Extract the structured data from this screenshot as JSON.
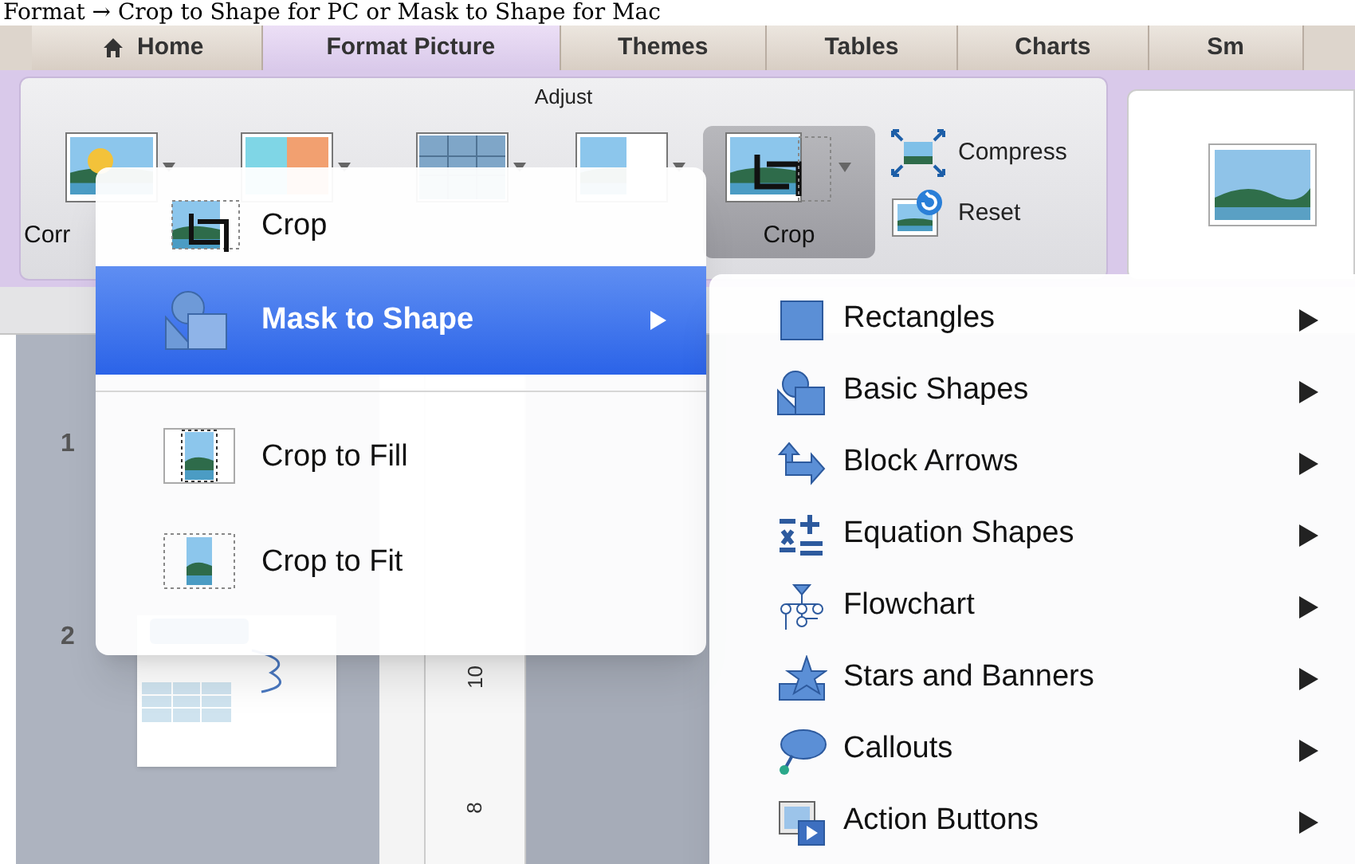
{
  "caption": "Format → Crop to Shape for PC or Mask to Shape for Mac",
  "tabs": [
    {
      "label": "Home",
      "kind": "home",
      "selected": false
    },
    {
      "label": "Format Picture",
      "kind": "plain",
      "selected": true
    },
    {
      "label": "Themes",
      "kind": "plain",
      "selected": false
    },
    {
      "label": "Tables",
      "kind": "plain",
      "selected": false
    },
    {
      "label": "Charts",
      "kind": "plain",
      "selected": false
    },
    {
      "label": "Sm",
      "kind": "plain",
      "selected": false
    }
  ],
  "ribbon": {
    "group": "Adjust",
    "buttons": [
      {
        "kind": "corrections",
        "label": "Corr",
        "pressed": false
      },
      {
        "kind": "color",
        "pressed": false
      },
      {
        "kind": "artistic",
        "pressed": false
      },
      {
        "kind": "background",
        "pressed": false
      },
      {
        "kind": "crop",
        "label": "Crop",
        "pressed": true
      }
    ],
    "small_buttons": [
      {
        "kind": "compress",
        "label": "Compress"
      },
      {
        "kind": "reset",
        "label": "Reset"
      }
    ]
  },
  "slides": [
    {
      "number": "1"
    },
    {
      "number": "2"
    }
  ],
  "ruler_labels": [
    "10",
    "8"
  ],
  "menu": {
    "items": [
      {
        "kind": "item",
        "label": "Crop",
        "selected": false,
        "has_submenu": false
      },
      {
        "kind": "item",
        "label": "Mask to Shape",
        "selected": true,
        "has_submenu": true
      },
      {
        "kind": "separator"
      },
      {
        "kind": "item",
        "label": "Crop to Fill",
        "selected": false,
        "has_submenu": false
      },
      {
        "kind": "item",
        "label": "Crop to Fit",
        "selected": false,
        "has_submenu": false
      }
    ]
  },
  "submenu": {
    "items": [
      {
        "label": "Rectangles",
        "has_submenu": true
      },
      {
        "label": "Basic Shapes",
        "has_submenu": true
      },
      {
        "label": "Block Arrows",
        "has_submenu": true
      },
      {
        "label": "Equation Shapes",
        "has_submenu": true
      },
      {
        "label": "Flowchart",
        "has_submenu": true
      },
      {
        "label": "Stars and Banners",
        "has_submenu": true
      },
      {
        "label": "Callouts",
        "has_submenu": true
      },
      {
        "label": "Action Buttons",
        "has_submenu": true
      }
    ]
  }
}
